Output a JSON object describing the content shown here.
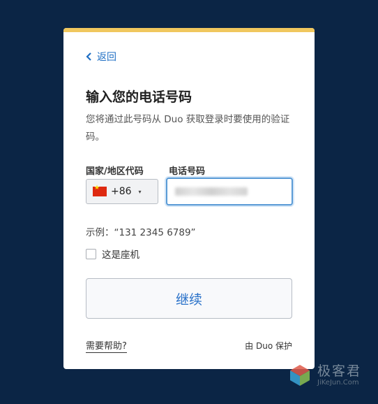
{
  "back": {
    "label": "返回",
    "icon": "chevron-left-icon"
  },
  "title": "输入您的电话号码",
  "description": "您将通过此号码从 Duo 获取登录时要使用的验证码。",
  "country": {
    "label": "国家/地区代码",
    "flag": "china-flag-icon",
    "code": "+86",
    "caret": "▾"
  },
  "phone": {
    "label": "电话号码",
    "value": ""
  },
  "example": "示例：“131 2345 6789”",
  "landline": {
    "label": "这是座机",
    "checked": false
  },
  "continue_label": "继续",
  "help_label": "需要帮助?",
  "secured_by": "由 Duo 保护",
  "watermark": {
    "title": "极客君",
    "subtitle": "JiKeJun.Com"
  },
  "colors": {
    "background": "#0b2545",
    "accent_bar": "#f0c75e",
    "link": "#1f6fc4"
  }
}
